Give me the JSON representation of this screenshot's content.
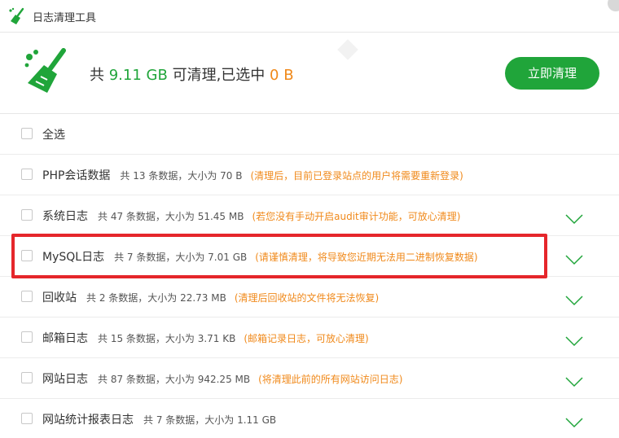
{
  "window": {
    "title": "日志清理工具"
  },
  "summary": {
    "prefix": "共 ",
    "total": "9.11 GB",
    "middle": " 可清理,已选中 ",
    "selected": "0 B",
    "button_label": "立即清理"
  },
  "select_all": {
    "label": "全选"
  },
  "items": [
    {
      "name": "PHP会话数据",
      "info": "共 13 条数据，大小为 70 B",
      "note": "(清理后，目前已登录站点的用户将需要重新登录)",
      "expandable": false
    },
    {
      "name": "系统日志",
      "info": "共 47 条数据，大小为 51.45 MB",
      "note": "(若您没有手动开启audit审计功能，可放心清理)",
      "expandable": true
    },
    {
      "name": "MySQL日志",
      "info": "共 7 条数据，大小为 7.01 GB",
      "note": "(请谨慎清理，将导致您近期无法用二进制恢复数据)",
      "expandable": true
    },
    {
      "name": "回收站",
      "info": "共 2 条数据，大小为 22.73 MB",
      "note": "(清理后回收站的文件将无法恢复)",
      "expandable": true
    },
    {
      "name": "邮箱日志",
      "info": "共 15 条数据，大小为 3.71 KB",
      "note": "(邮箱记录日志，可放心清理)",
      "expandable": true
    },
    {
      "name": "网站日志",
      "info": "共 87 条数据，大小为 942.25 MB",
      "note": "(将清理此前的所有网站访问日志)",
      "expandable": true
    },
    {
      "name": "网站统计报表日志",
      "info": "共 7 条数据，大小为 1.11 GB",
      "note": "",
      "expandable": true
    }
  ],
  "colors": {
    "accent": "#20a53a",
    "warning": "#f0891a",
    "highlight": "#e5262b"
  },
  "icons": {
    "app": "broom-icon",
    "expand": "chevron-down-icon"
  }
}
